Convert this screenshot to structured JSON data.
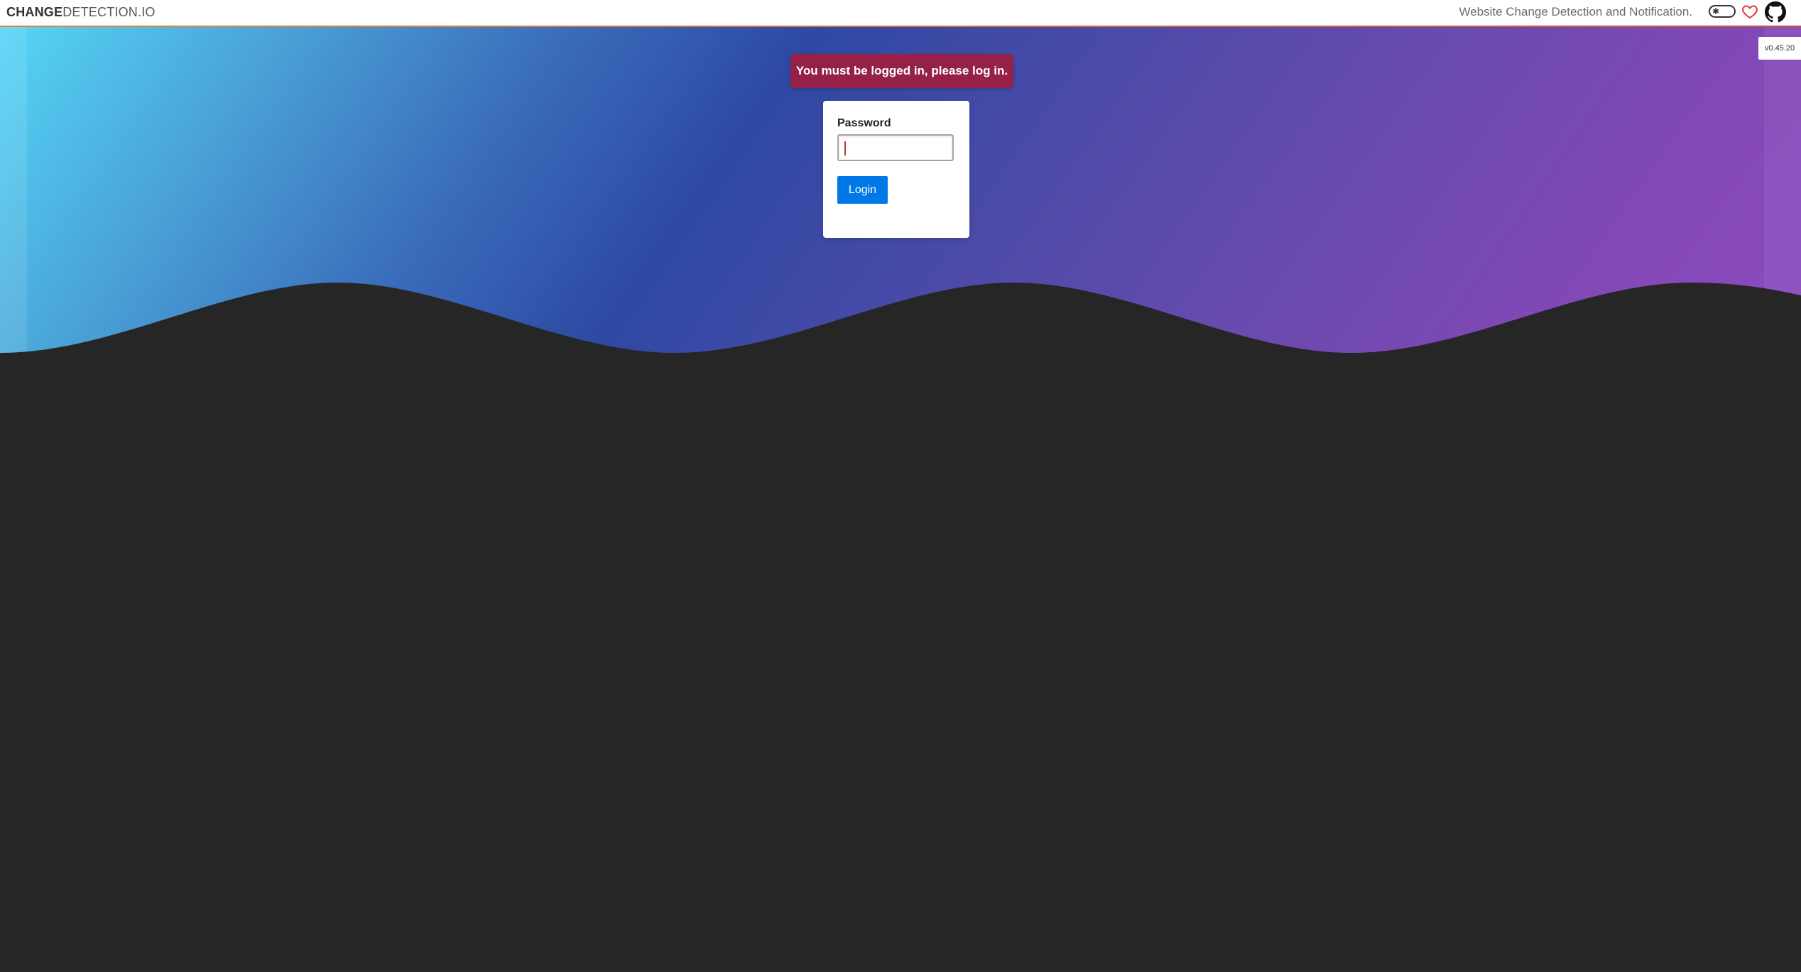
{
  "header": {
    "brand_strong": "CHANGE",
    "brand_rest": "DETECTION.IO",
    "tagline": "Website Change Detection and Notification.",
    "icons": [
      "theme-toggle-icon",
      "heart-icon",
      "github-icon"
    ]
  },
  "version": "v0.45.20",
  "flash": {
    "message": "You must be logged in, please log in.",
    "color": "#962148"
  },
  "login": {
    "password_label": "Password",
    "password_value": "",
    "button_label": "Login",
    "button_color": "#0078e7"
  },
  "colors": {
    "background": "#262626",
    "header_rule": "#d9763a"
  }
}
